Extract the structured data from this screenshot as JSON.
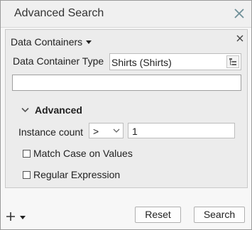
{
  "dialog": {
    "title": "Advanced Search",
    "close_icon": "close-icon"
  },
  "data_containers": {
    "header_label": "Data Containers",
    "type_label": "Data Container Type",
    "type_value": "Shirts (Shirts)",
    "browse_icon": "tree-browse-icon",
    "search_text": ""
  },
  "advanced": {
    "label": "Advanced",
    "expanded": true,
    "instance_count_label": "Instance count",
    "operator": ">",
    "count_value": "1",
    "match_case_label": "Match Case on Values",
    "match_case_checked": false,
    "regex_label": "Regular Expression",
    "regex_checked": false
  },
  "footer": {
    "add_icon": "plus-icon",
    "reset_label": "Reset",
    "search_label": "Search"
  }
}
